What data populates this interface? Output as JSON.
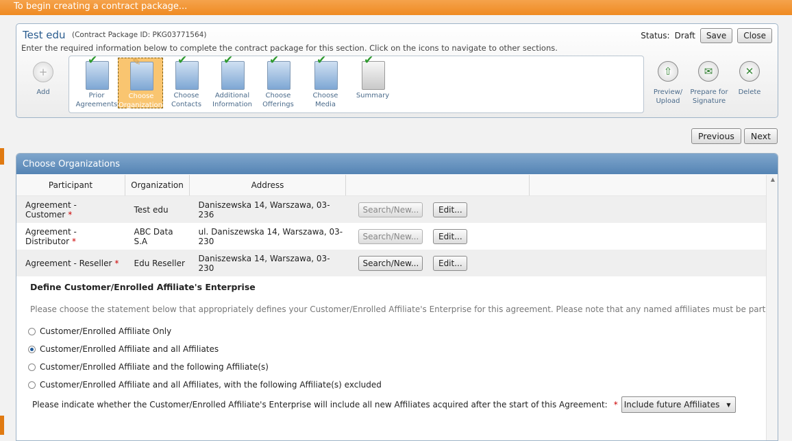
{
  "topbar": {
    "title": "To begin creating a contract package..."
  },
  "package": {
    "title": "Test edu",
    "id_text": "(Contract Package ID: PKG03771564)",
    "instructions": "Enter the required information below to complete the contract package for this section. Click on the icons to navigate to other sections.",
    "status_label": "Status:",
    "status_value": "Draft",
    "save_label": "Save",
    "close_label": "Close"
  },
  "nav": {
    "add_label": "Add",
    "steps": [
      {
        "label": "Prior Agreements",
        "state": "complete"
      },
      {
        "label": "Choose Organizations",
        "state": "active"
      },
      {
        "label": "Choose Contacts",
        "state": "complete"
      },
      {
        "label": "Additional Information",
        "state": "complete"
      },
      {
        "label": "Choose Offerings",
        "state": "complete"
      },
      {
        "label": "Choose Media",
        "state": "complete"
      },
      {
        "label": "Summary",
        "state": "complete"
      }
    ],
    "preview_label": "Preview/ Upload",
    "prepare_label": "Prepare for Signature",
    "delete_label": "Delete"
  },
  "pager": {
    "previous": "Previous",
    "next": "Next"
  },
  "section": {
    "title": "Choose Organizations",
    "columns": [
      "Participant",
      "Organization",
      "Address"
    ],
    "rows": [
      {
        "participant": "Agreement - Customer",
        "organization": "Test edu",
        "address": "Daniszewska 14, Warszawa,  03-236",
        "search": "Search/New...",
        "search_disabled": true,
        "edit": "Edit..."
      },
      {
        "participant": "Agreement - Distributor",
        "organization": "ABC Data S.A",
        "address": "ul. Daniszewska 14, Warszawa,  03-230",
        "search": "Search/New...",
        "search_disabled": true,
        "edit": "Edit..."
      },
      {
        "participant": "Agreement - Reseller",
        "organization": "Edu Reseller",
        "address": "Daniszewska 14, Warszawa,  03-230",
        "search": "Search/New...",
        "search_disabled": false,
        "edit": "Edit..."
      }
    ]
  },
  "enterprise": {
    "title": "Define Customer/Enrolled Affiliate's Enterprise",
    "description": "Please choose the statement below that appropriately defines your Customer/Enrolled Affiliate's Enterprise for this agreement. Please note that any named affiliates must be part of your Customer/Enrolled",
    "options": [
      {
        "label": "Customer/Enrolled Affiliate Only",
        "selected": false
      },
      {
        "label": "Customer/Enrolled Affiliate and all Affiliates",
        "selected": true
      },
      {
        "label": "Customer/Enrolled Affiliate and the following Affiliate(s)",
        "selected": false
      },
      {
        "label": "Customer/Enrolled Affiliate and all Affiliates, with the following Affiliate(s) excluded",
        "selected": false
      }
    ],
    "future_question": "Please indicate whether the Customer/Enrolled Affiliate's Enterprise will include all new Affiliates acquired after the start of this Agreement:",
    "future_value": "Include future Affiliates"
  }
}
